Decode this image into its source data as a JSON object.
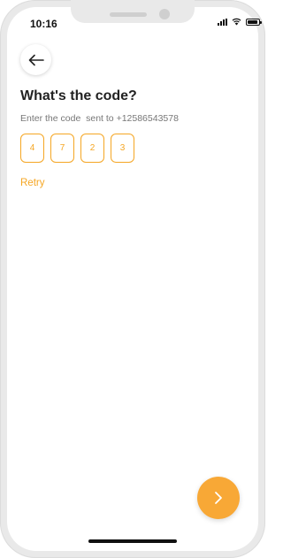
{
  "status_bar": {
    "time": "10:16"
  },
  "screen": {
    "title": "What's the code?",
    "subtitle": "Enter the code  sent to +12586543578",
    "code_digits": [
      "4",
      "7",
      "2",
      "3"
    ],
    "retry_label": "Retry"
  },
  "icons": {
    "back": "arrow-left-icon",
    "next": "chevron-right-icon"
  },
  "colors": {
    "accent": "#f5a623",
    "next_button": "#f8a836",
    "title": "#222222",
    "subtitle": "#777777"
  }
}
